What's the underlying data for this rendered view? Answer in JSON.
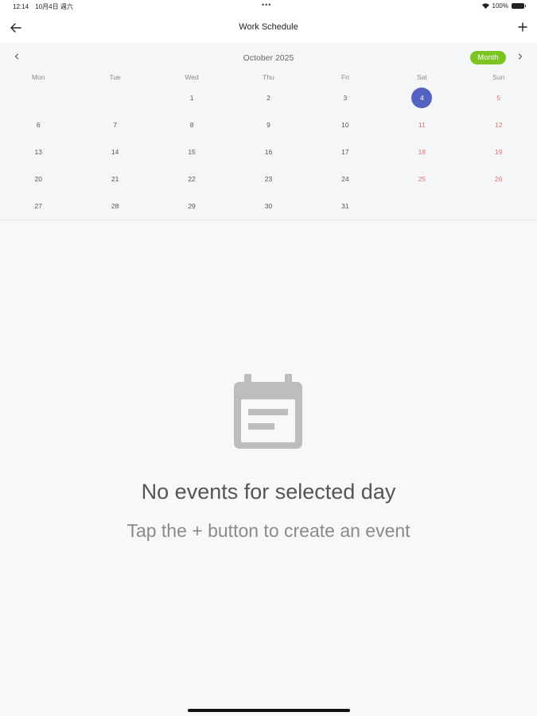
{
  "status_bar": {
    "time": "12:14",
    "date": "10月4日 週六",
    "battery": "100%",
    "center_dots": "•••"
  },
  "nav": {
    "title": "Work Schedule",
    "back_icon": "arrow-left-icon",
    "add_icon": "plus-icon"
  },
  "calendar": {
    "month_title": "October 2025",
    "view_toggle": "Month",
    "weekdays": [
      "Mon",
      "Tue",
      "Wed",
      "Thu",
      "Fri",
      "Sat",
      "Sun"
    ],
    "weeks": [
      [
        "",
        "",
        "1",
        "2",
        "3",
        "4",
        "5"
      ],
      [
        "6",
        "7",
        "8",
        "9",
        "10",
        "11",
        "12"
      ],
      [
        "13",
        "14",
        "15",
        "16",
        "17",
        "18",
        "19"
      ],
      [
        "20",
        "21",
        "22",
        "23",
        "24",
        "25",
        "26"
      ],
      [
        "27",
        "28",
        "29",
        "30",
        "31",
        "",
        ""
      ]
    ],
    "selected_day": "4",
    "colors": {
      "selected": "#5462c2",
      "weekend": "#e07070",
      "toggle": "#7cc421"
    }
  },
  "empty_state": {
    "icon": "calendar-icon",
    "title": "No events for selected day",
    "subtitle": "Tap the + button to create an event"
  }
}
